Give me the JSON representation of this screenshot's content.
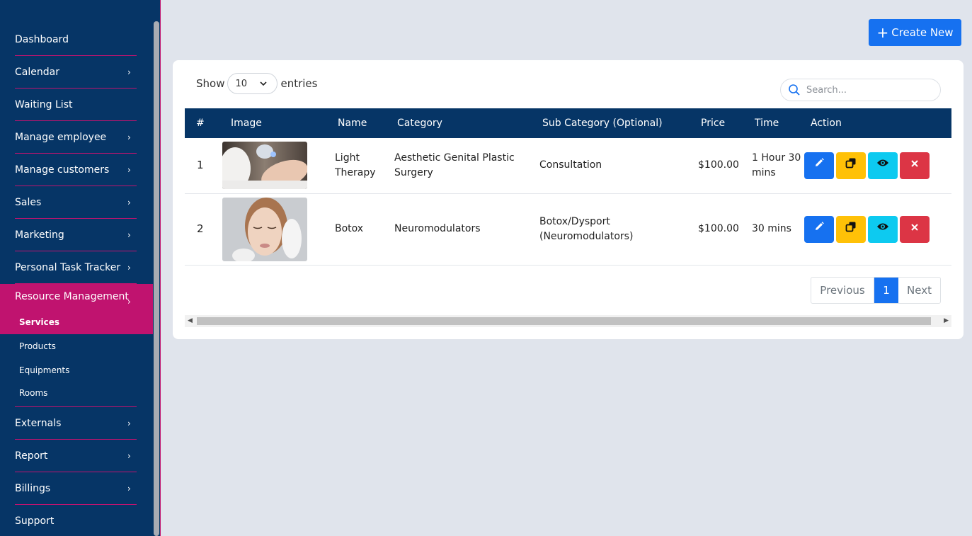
{
  "sidebar": {
    "items": [
      {
        "label": "Dashboard"
      },
      {
        "label": "Calendar",
        "chevron": "›"
      },
      {
        "label": "Waiting List"
      },
      {
        "label": "Manage employee",
        "chevron": "›"
      },
      {
        "label": "Manage customers",
        "chevron": "›"
      },
      {
        "label": "Sales",
        "chevron": "›"
      },
      {
        "label": "Marketing",
        "chevron": "›"
      },
      {
        "label": "Personal Task Tracker",
        "chevron": "›"
      },
      {
        "label": "Resource Management",
        "chevron": "›"
      },
      {
        "label": "Externals",
        "chevron": "›"
      },
      {
        "label": "Report",
        "chevron": "›"
      },
      {
        "label": "Billings",
        "chevron": "›"
      },
      {
        "label": "Support"
      }
    ],
    "sub_items": [
      {
        "label": "Services"
      },
      {
        "label": "Products"
      },
      {
        "label": "Equipments"
      },
      {
        "label": "Rooms"
      }
    ]
  },
  "toolbar": {
    "create_label": "Create New",
    "create_icon": "+"
  },
  "controls": {
    "show_label": "Show",
    "entries_value": "10",
    "entries_label": "entries",
    "search_placeholder": "Search..."
  },
  "table": {
    "headers": [
      "#",
      "Image",
      "Name",
      "Category",
      "Sub Category (Optional)",
      "Price",
      "Time",
      "Action"
    ],
    "rows": [
      {
        "num": "1",
        "image": "light-therapy-photo",
        "name": "Light Therapy",
        "category": "Aesthetic Genital Plastic Surgery",
        "subcategory": "Consultation",
        "price": "$100.00",
        "time": "1 Hour 30 mins"
      },
      {
        "num": "2",
        "image": "botox-photo",
        "name": "Botox",
        "category": "Neuromodulators",
        "subcategory": "Botox/Dysport (Neuromodulators)",
        "price": "$100.00",
        "time": "30 mins"
      }
    ],
    "actions": [
      "pencil-icon",
      "copy-icon",
      "eye-icon",
      "close-icon"
    ]
  },
  "pagination": {
    "previous": "Previous",
    "current": "1",
    "next": "Next"
  },
  "colors": {
    "sidebar_bg": "#063566",
    "accent_pink": "#c0136f",
    "primary": "#1671f0",
    "warning": "#ffc107",
    "info": "#0dcaf0",
    "danger": "#dc3545"
  }
}
